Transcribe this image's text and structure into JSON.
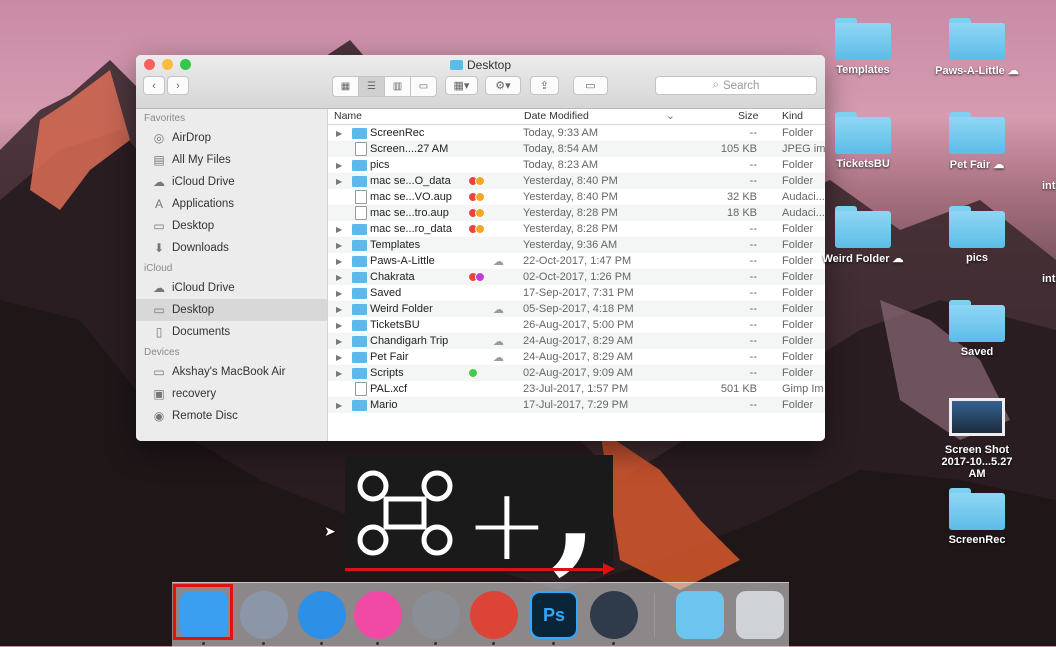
{
  "window": {
    "title": "Desktop",
    "back": "‹",
    "forward": "›",
    "search_placeholder": "Search"
  },
  "sidebar": {
    "favorites_header": "Favorites",
    "favorites": [
      {
        "label": "AirDrop",
        "icon": "airdrop-icon"
      },
      {
        "label": "All My Files",
        "icon": "all-files-icon"
      },
      {
        "label": "iCloud Drive",
        "icon": "cloud-icon"
      },
      {
        "label": "Applications",
        "icon": "applications-icon"
      },
      {
        "label": "Desktop",
        "icon": "desktop-icon"
      },
      {
        "label": "Downloads",
        "icon": "downloads-icon"
      }
    ],
    "icloud_header": "iCloud",
    "icloud": [
      {
        "label": "iCloud Drive",
        "icon": "cloud-icon"
      },
      {
        "label": "Desktop",
        "icon": "desktop-icon",
        "selected": true
      },
      {
        "label": "Documents",
        "icon": "documents-icon"
      }
    ],
    "devices_header": "Devices",
    "devices": [
      {
        "label": "Akshay's MacBook Air",
        "icon": "laptop-icon"
      },
      {
        "label": "recovery",
        "icon": "disk-icon"
      },
      {
        "label": "Remote Disc",
        "icon": "disc-icon"
      }
    ]
  },
  "columns": {
    "name": "Name",
    "date": "Date Modified",
    "size": "Size",
    "kind": "Kind"
  },
  "files": [
    {
      "name": "ScreenRec",
      "date": "Today, 9:33 AM",
      "size": "--",
      "kind": "Folder",
      "folder": true,
      "expand": true
    },
    {
      "name": "Screen....27 AM",
      "date": "Today, 8:54 AM",
      "size": "105 KB",
      "kind": "JPEG im",
      "folder": false,
      "expand": false
    },
    {
      "name": "pics",
      "date": "Today, 8:23 AM",
      "size": "--",
      "kind": "Folder",
      "folder": true,
      "expand": true
    },
    {
      "name": "mac se...O_data",
      "date": "Yesterday, 8:40 PM",
      "size": "--",
      "kind": "Folder",
      "folder": true,
      "expand": true,
      "tags": [
        "#e8453c",
        "#f5a623"
      ]
    },
    {
      "name": "mac se...VO.aup",
      "date": "Yesterday, 8:40 PM",
      "size": "32 KB",
      "kind": "Audaci...",
      "folder": false,
      "expand": false,
      "tags": [
        "#e8453c",
        "#f5a623"
      ]
    },
    {
      "name": "mac se...tro.aup",
      "date": "Yesterday, 8:28 PM",
      "size": "18 KB",
      "kind": "Audaci...",
      "folder": false,
      "expand": false,
      "tags": [
        "#e8453c",
        "#f5a623"
      ]
    },
    {
      "name": "mac se...ro_data",
      "date": "Yesterday, 8:28 PM",
      "size": "--",
      "kind": "Folder",
      "folder": true,
      "expand": true,
      "tags": [
        "#e8453c",
        "#f5a623"
      ]
    },
    {
      "name": "Templates",
      "date": "Yesterday, 9:36 AM",
      "size": "--",
      "kind": "Folder",
      "folder": true,
      "expand": true
    },
    {
      "name": "Paws-A-Little",
      "date": "22-Oct-2017, 1:47 PM",
      "size": "--",
      "kind": "Folder",
      "folder": true,
      "expand": true,
      "cloud": true
    },
    {
      "name": "Chakrata",
      "date": "02-Oct-2017, 1:26 PM",
      "size": "--",
      "kind": "Folder",
      "folder": true,
      "expand": true,
      "tags": [
        "#e8453c",
        "#c03ed6"
      ]
    },
    {
      "name": "Saved",
      "date": "17-Sep-2017, 7:31 PM",
      "size": "--",
      "kind": "Folder",
      "folder": true,
      "expand": true
    },
    {
      "name": "Weird Folder",
      "date": "05-Sep-2017, 4:18 PM",
      "size": "--",
      "kind": "Folder",
      "folder": true,
      "expand": true,
      "cloud": true
    },
    {
      "name": "TicketsBU",
      "date": "26-Aug-2017, 5:00 PM",
      "size": "--",
      "kind": "Folder",
      "folder": true,
      "expand": true
    },
    {
      "name": "Chandigarh Trip",
      "date": "24-Aug-2017, 8:29 AM",
      "size": "--",
      "kind": "Folder",
      "folder": true,
      "expand": true,
      "cloud": true
    },
    {
      "name": "Pet Fair",
      "date": "24-Aug-2017, 8:29 AM",
      "size": "--",
      "kind": "Folder",
      "folder": true,
      "expand": true,
      "cloud": true
    },
    {
      "name": "Scripts",
      "date": "02-Aug-2017, 9:09 AM",
      "size": "--",
      "kind": "Folder",
      "folder": true,
      "expand": true,
      "tags": [
        "#3fcf4a"
      ]
    },
    {
      "name": "PAL.xcf",
      "date": "23-Jul-2017, 1:57 PM",
      "size": "501 KB",
      "kind": "Gimp Im",
      "folder": false,
      "expand": false
    },
    {
      "name": "Mario",
      "date": "17-Jul-2017, 7:29 PM",
      "size": "--",
      "kind": "Folder",
      "folder": true,
      "expand": true
    }
  ],
  "desktop_icons": [
    {
      "label": "Templates",
      "kind": "folder"
    },
    {
      "label": "Paws-A-Little",
      "kind": "folder",
      "cloud": true
    },
    {
      "label": "TicketsBU",
      "kind": "folder"
    },
    {
      "label": "Pet Fair",
      "kind": "folder",
      "cloud": true
    },
    {
      "label": "Weird Folder",
      "kind": "folder",
      "cloud": true
    },
    {
      "label": "pics",
      "kind": "folder"
    },
    {
      "label": "Saved",
      "kind": "folder"
    },
    {
      "label": "Screen Shot 2017-10...5.27 AM",
      "kind": "screenshot"
    },
    {
      "label": "ScreenRec",
      "kind": "folder"
    }
  ],
  "edge_labels": [
    "int",
    "int"
  ],
  "shortcut": {
    "plus": "+",
    "key": ","
  },
  "dock": [
    {
      "name": "finder",
      "label": "",
      "color": "#3a9ff0"
    },
    {
      "name": "launchpad",
      "label": "",
      "color": "#8b97a8"
    },
    {
      "name": "safari",
      "label": "",
      "color": "#2d8fe6"
    },
    {
      "name": "itunes",
      "label": "",
      "color": "#f04aa5"
    },
    {
      "name": "system-preferences",
      "label": "",
      "color": "#8a8f96"
    },
    {
      "name": "chrome",
      "label": "",
      "color": "#db4437"
    },
    {
      "name": "photoshop",
      "label": "Ps",
      "color": "#0b2538"
    },
    {
      "name": "quicktime",
      "label": "",
      "color": "#2f3a4a"
    },
    {
      "name": "downloads-folder",
      "label": "",
      "color": "#6cc5ee"
    },
    {
      "name": "trash",
      "label": "",
      "color": "#cfd3d6"
    }
  ]
}
